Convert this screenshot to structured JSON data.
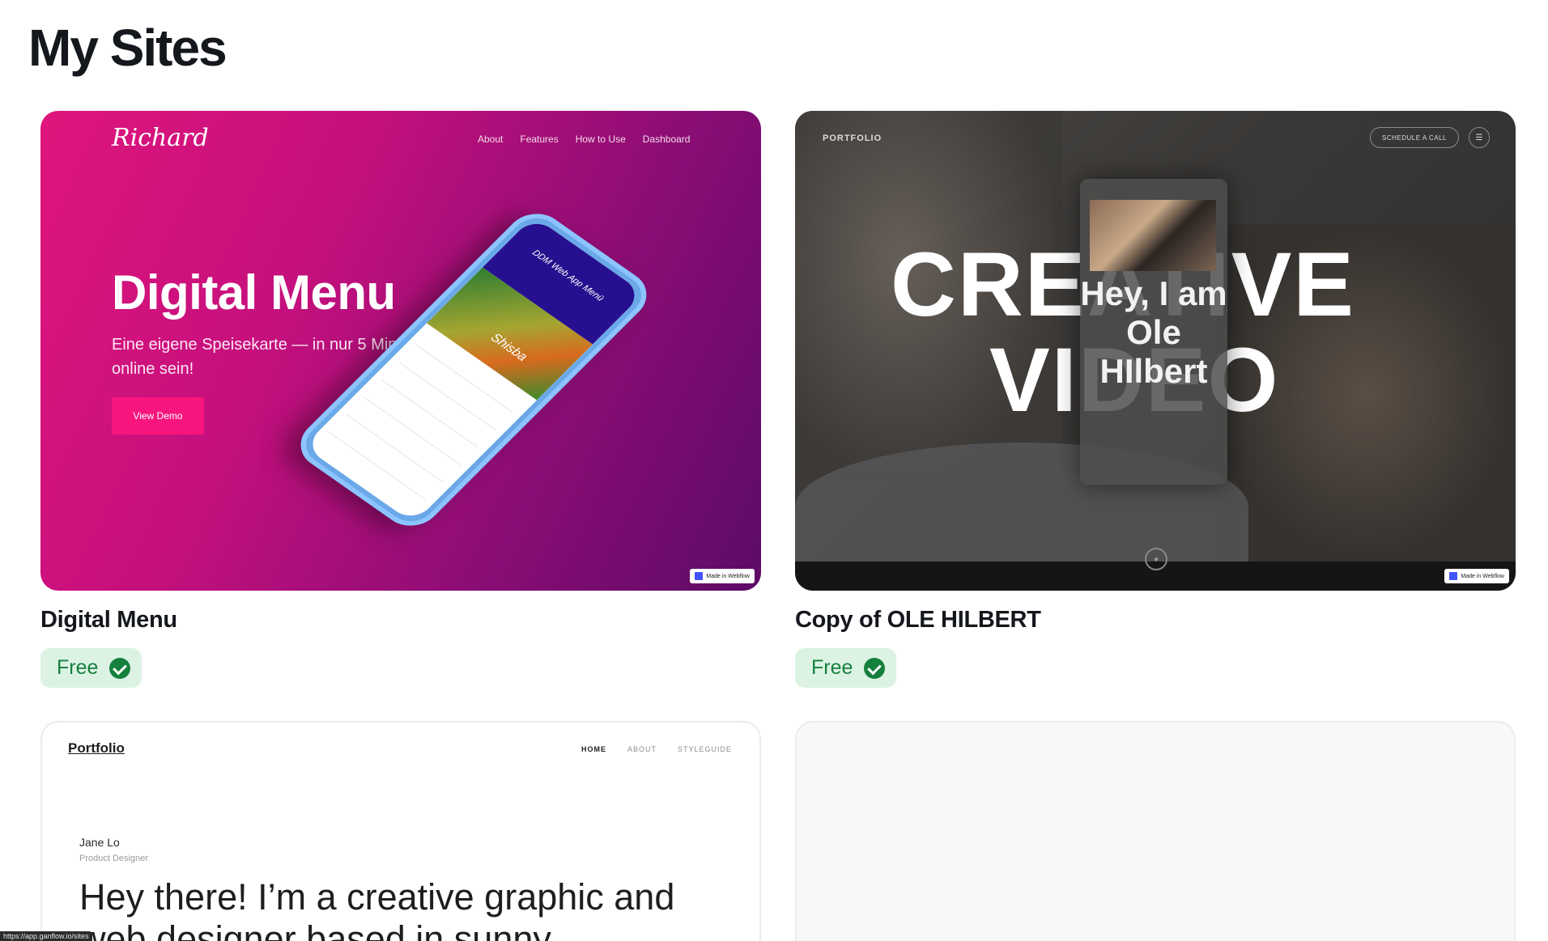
{
  "page": {
    "title": "My Sites"
  },
  "sites": [
    {
      "name": "Digital Menu",
      "plan": "Free",
      "preview": {
        "logo": "Richard",
        "nav": [
          "About",
          "Features",
          "How to Use",
          "Dashboard"
        ],
        "hero_title": "Digital Menu",
        "hero_subtitle": "Eine eigene Speisekarte — in nur 5 Minuten online sein!",
        "cta_label": "View Demo",
        "phone_header": "DDM Web App Menü",
        "phone_food_label": "Shisba",
        "webflow_badge": "Made in Webflow",
        "accent": "#e0157d"
      }
    },
    {
      "name": "Copy of OLE HILBERT",
      "plan": "Free",
      "preview": {
        "brand": "PORTFOLIO",
        "cta_label": "SCHEDULE A CALL",
        "menu_icon": "☰",
        "headline_line1": "CREATIVE",
        "headline_line2": "VIDEO",
        "video_text": "Hey, I am Ole HIlbert",
        "scroll_icon": "●",
        "webflow_badge": "Made in Webflow"
      }
    },
    {
      "preview": {
        "logo": "Portfolio",
        "nav_active": "HOME",
        "nav": [
          "ABOUT",
          "STYLEGUIDE"
        ],
        "author": "Jane Lo",
        "role": "Product Designer",
        "headline": "Hey there! I’m a creative graphic and web designer based in sunny"
      }
    },
    {}
  ],
  "status_tooltip": "https://app.ganflow.io/sites",
  "colors": {
    "badge_bg": "#dcf3e4",
    "badge_fg": "#15803d"
  }
}
